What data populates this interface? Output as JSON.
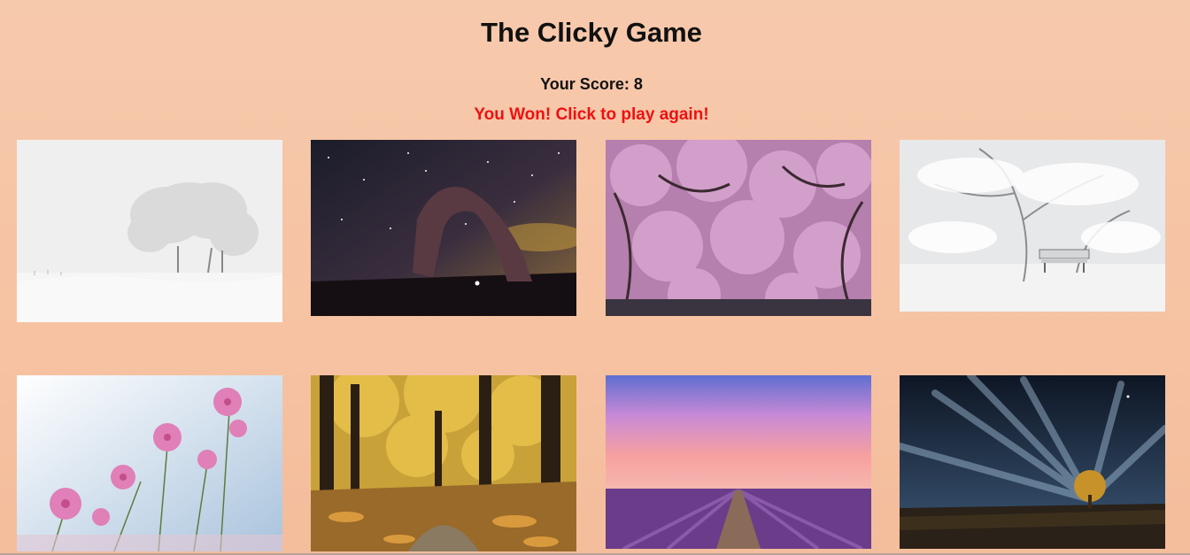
{
  "header": {
    "title": "The Clicky Game",
    "score_label": "Your Score: 8",
    "status_message": "You Won! Click to play again!"
  },
  "colors": {
    "background": "#f6c4a5",
    "message": "#ee1111",
    "text": "#111111"
  },
  "cards": [
    {
      "name": "snowy-field-trees"
    },
    {
      "name": "starry-night-arch"
    },
    {
      "name": "pink-cherry-blossom"
    },
    {
      "name": "snowy-bench-trees"
    },
    {
      "name": "pink-cosmos-flowers"
    },
    {
      "name": "autumn-forest-path"
    },
    {
      "name": "lavender-field-sunset"
    },
    {
      "name": "night-sky-lone-tree"
    }
  ]
}
